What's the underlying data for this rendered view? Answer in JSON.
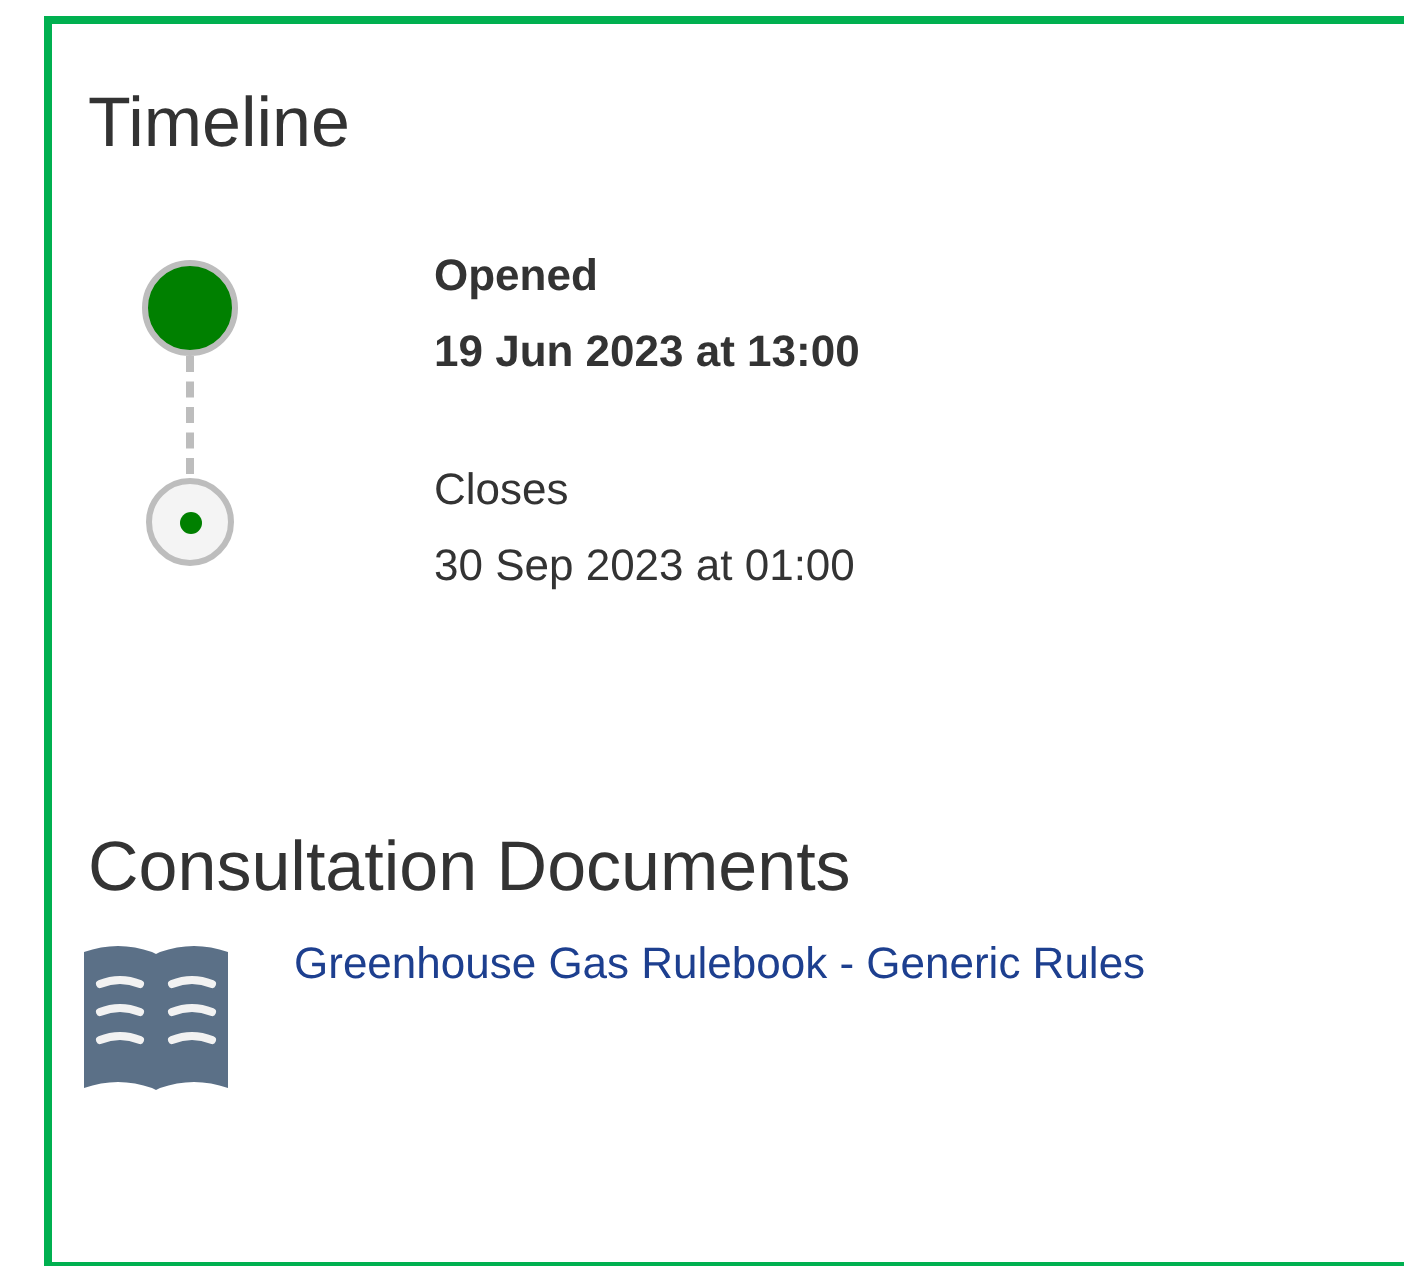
{
  "timeline": {
    "title": "Timeline",
    "events": [
      {
        "label": "Opened",
        "date": "19 Jun 2023 at 13:00",
        "completed": true
      },
      {
        "label": "Closes",
        "date": "30 Sep 2023 at 01:00",
        "completed": false
      }
    ]
  },
  "documents": {
    "title": "Consultation Documents",
    "items": [
      {
        "title": "Greenhouse Gas Rulebook - Generic Rules"
      }
    ]
  }
}
